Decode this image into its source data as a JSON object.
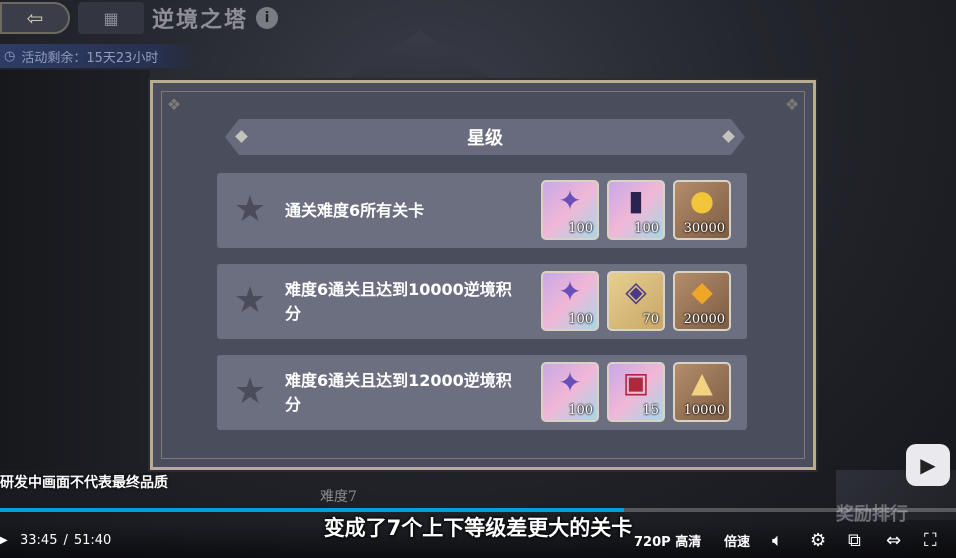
{
  "game": {
    "back_icon": "arrow-left",
    "title": "逆境之塔",
    "info_icon": "info",
    "timer_label": "活动剩余：15天23小时"
  },
  "modal": {
    "title": "星级",
    "rows": [
      {
        "text": "通关难度6所有关卡",
        "rewards": [
          {
            "icon": "star-crystal",
            "qty": "100"
          },
          {
            "icon": "card",
            "qty": "100"
          },
          {
            "icon": "gold-coin",
            "qty": "30000"
          }
        ]
      },
      {
        "text": "难度6通关且达到10000逆境积分",
        "rewards": [
          {
            "icon": "star-crystal",
            "qty": "100"
          },
          {
            "icon": "rune-gem",
            "qty": "70"
          },
          {
            "icon": "gold-ore",
            "qty": "20000"
          }
        ]
      },
      {
        "text": "难度6通关且达到12000逆境积分",
        "rewards": [
          {
            "icon": "star-crystal",
            "qty": "100"
          },
          {
            "icon": "treasure-chest",
            "qty": "15"
          },
          {
            "icon": "gold-pile",
            "qty": "10000"
          }
        ]
      }
    ]
  },
  "hud": {
    "difficulty_label": "难度7",
    "ranking_label": "奖励排行"
  },
  "video": {
    "disclaimer": "研发中画面不代表最终品质",
    "subtitle": "变成了7个上下等级差更大的关卡",
    "current_time": "33:45",
    "separator": "/",
    "duration": "51:40",
    "progress": 0.653,
    "quality": "720P 高清",
    "speed_label": "倍速",
    "accent_color": "#00a1d6"
  }
}
